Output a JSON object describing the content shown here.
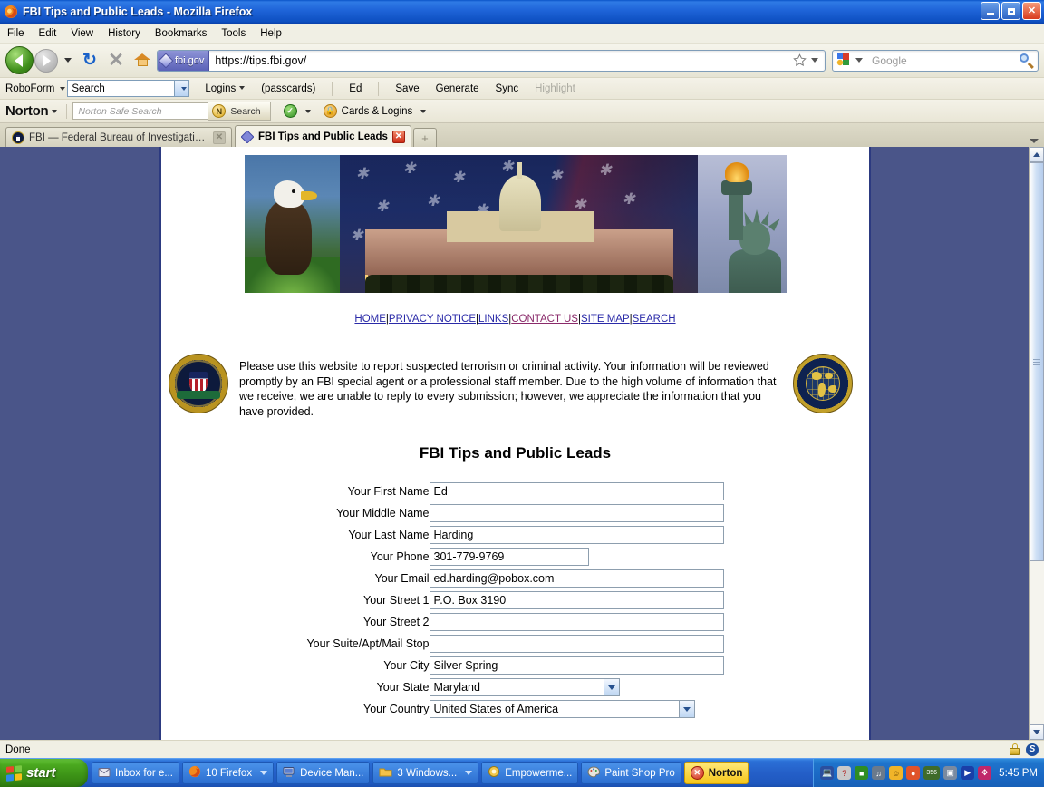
{
  "window": {
    "title": "FBI Tips and Public Leads - Mozilla Firefox",
    "minimize_label": "Minimize",
    "restore_label": "Restore",
    "close_label": "Close"
  },
  "menubar": [
    {
      "label": "File",
      "accel": "F"
    },
    {
      "label": "Edit",
      "accel": "E"
    },
    {
      "label": "View",
      "accel": "V"
    },
    {
      "label": "History",
      "accel": "s"
    },
    {
      "label": "Bookmarks",
      "accel": "B"
    },
    {
      "label": "Tools",
      "accel": "T"
    },
    {
      "label": "Help",
      "accel": "H"
    }
  ],
  "navbar": {
    "back_label": "Back",
    "forward_label": "Forward",
    "reload_glyph": "↻",
    "stop_glyph": "✕",
    "home_label": "Home",
    "identity_label": "fbi.gov",
    "url": "https://tips.fbi.gov/",
    "bookmark_label": "Bookmark this page",
    "search_placeholder": "Google",
    "search_value": ""
  },
  "roboform": {
    "brand": "RoboForm",
    "search_value": "Search",
    "logins_label": "Logins",
    "passcards_label": "(passcards)",
    "identity_label": "Ed",
    "save_label": "Save",
    "generate_label": "Generate",
    "sync_label": "Sync",
    "highlight_label": "Highlight"
  },
  "norton": {
    "brand": "Norton",
    "search_placeholder": "Norton Safe Search",
    "search_button": "Search",
    "cards_logins_label": "Cards & Logins"
  },
  "tabs": [
    {
      "title": "FBI — Federal Bureau of Investigation ...",
      "active": false
    },
    {
      "title": "FBI Tips and Public Leads",
      "active": true
    }
  ],
  "newtab_label": "+",
  "page": {
    "banner_alt": "Bald eagle, U.S. Capitol with flag, Statue of Liberty torch",
    "nav_links": [
      {
        "label": "HOME",
        "visited": false
      },
      {
        "label": "PRIVACY NOTICE",
        "visited": false
      },
      {
        "label": "LINKS",
        "visited": false
      },
      {
        "label": "CONTACT US",
        "visited": true
      },
      {
        "label": "SITE MAP",
        "visited": false
      },
      {
        "label": "SEARCH",
        "visited": false
      }
    ],
    "nav_separator": "|",
    "intro_text": "Please use this website to report suspected terrorism or criminal activity.  Your information will be reviewed promptly by an FBI special agent or a professional staff member. Due to the high volume of information that we receive, we are unable to reply to every submission; however, we appreciate the information that you have provided.",
    "form_title": "FBI Tips and Public Leads",
    "fields": [
      {
        "label": "Your First Name",
        "value": "Ed",
        "type": "text",
        "width": "full"
      },
      {
        "label": "Your Middle Name",
        "value": "",
        "type": "text",
        "width": "full"
      },
      {
        "label": "Your Last Name",
        "value": "Harding",
        "type": "text",
        "width": "full"
      },
      {
        "label": "Your Phone",
        "value": "301-779-9769",
        "type": "text",
        "width": "mid"
      },
      {
        "label": "Your Email",
        "value": "ed.harding@pobox.com",
        "type": "text",
        "width": "full"
      },
      {
        "label": "Your Street 1",
        "value": "P.O. Box 3190",
        "type": "text",
        "width": "full"
      },
      {
        "label": "Your Street 2",
        "value": "",
        "type": "text",
        "width": "full"
      },
      {
        "label": "Your Suite/Apt/Mail Stop",
        "value": "",
        "type": "text",
        "width": "full"
      },
      {
        "label": "Your City",
        "value": "Silver Spring",
        "type": "text",
        "width": "full"
      },
      {
        "label": "Your State",
        "value": "Maryland",
        "type": "select",
        "width": "state"
      },
      {
        "label": "Your Country",
        "value": "United States of America",
        "type": "select",
        "width": "country"
      }
    ]
  },
  "statusbar": {
    "text": "Done",
    "secure_label": "Secure connection",
    "script_label": "S"
  },
  "taskbar": {
    "start_label": "start",
    "items": [
      {
        "label": "Inbox for e...",
        "icon": "mail-icon",
        "style": "normal",
        "caret": false
      },
      {
        "label": "10 Firefox",
        "icon": "firefox-icon",
        "style": "normal",
        "caret": true
      },
      {
        "label": "Device Man...",
        "icon": "computer-icon",
        "style": "normal",
        "caret": false
      },
      {
        "label": "3 Windows...",
        "icon": "folder-icon",
        "style": "normal",
        "caret": true
      },
      {
        "label": "Empowerme...",
        "icon": "app-icon",
        "style": "normal",
        "caret": false
      },
      {
        "label": "Paint Shop Pro",
        "icon": "palette-icon",
        "style": "normal",
        "caret": false
      },
      {
        "label": "Norton",
        "icon": "norton-icon",
        "style": "norton",
        "caret": false
      }
    ],
    "tray_count_badge": "356",
    "clock": "5:45 PM"
  },
  "colors": {
    "titlebar_blue": "#1e63d8",
    "desktop_blue": "#4a5589",
    "page_border": "#2c3a80",
    "link_blue": "#2a2aa8",
    "link_visited": "#8a2a6a",
    "taskbar_blue": "#245fc8",
    "start_green": "#4aa81f",
    "norton_yellow": "#f5c61a"
  }
}
